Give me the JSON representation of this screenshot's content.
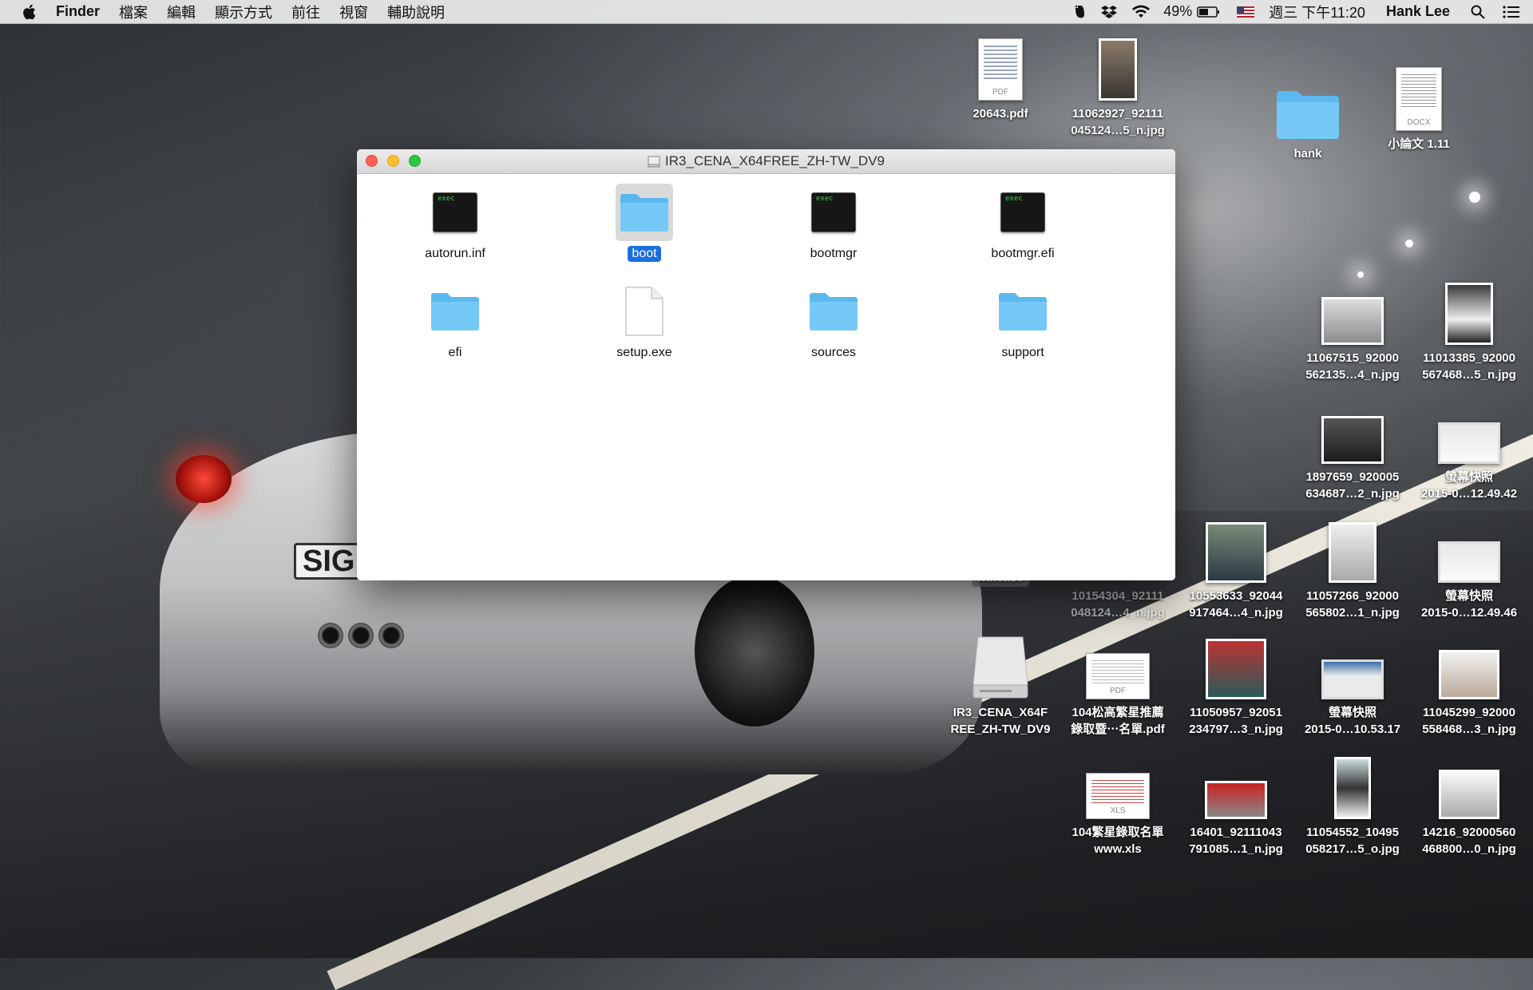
{
  "menubar": {
    "app_name": "Finder",
    "menus": [
      "檔案",
      "編輯",
      "顯示方式",
      "前往",
      "視窗",
      "輔助說明"
    ],
    "battery": "49%",
    "datetime": "週三 下午11:20",
    "user": "Hank Lee",
    "icons": [
      "apple-logo-icon",
      "evernote-icon",
      "dropbox-icon",
      "wifi-icon",
      "battery-icon",
      "flag-us-icon",
      "spotlight-search-icon",
      "notification-center-icon"
    ]
  },
  "wallpaper": {
    "plate_text": "SIG"
  },
  "window": {
    "title": "IR3_CENA_X64FREE_ZH-TW_DV9",
    "items": [
      {
        "name": "autorun.inf",
        "kind": "exec",
        "badge": "exec"
      },
      {
        "name": "boot",
        "kind": "folder",
        "selected": true
      },
      {
        "name": "bootmgr",
        "kind": "exec",
        "badge": "exec"
      },
      {
        "name": "bootmgr.efi",
        "kind": "exec",
        "badge": "exec"
      },
      {
        "name": "efi",
        "kind": "folder"
      },
      {
        "name": "setup.exe",
        "kind": "document"
      },
      {
        "name": "sources",
        "kind": "folder"
      },
      {
        "name": "support",
        "kind": "folder"
      }
    ]
  },
  "desktop": {
    "items": [
      {
        "line1": "20643.pdf",
        "line2": "",
        "kind": "pdf",
        "badge": "PDF"
      },
      {
        "line1": "11062927_92111",
        "line2": "045124…5_n.jpg",
        "kind": "photo"
      },
      {
        "line1": "hank",
        "line2": "",
        "kind": "folder"
      },
      {
        "line1": "小論文  1.11",
        "line2": "",
        "kind": "docx",
        "badge": "DOCX"
      },
      {
        "line1": "11067515_92000",
        "line2": "562135…4_n.jpg",
        "kind": "photo"
      },
      {
        "line1": "11013385_92000",
        "line2": "567468…5_n.jpg",
        "kind": "photo"
      },
      {
        "line1": "1897659_920005",
        "line2": "634687…2_n.jpg",
        "kind": "photo"
      },
      {
        "line1": "螢幕快照",
        "line2": "2015-0…12.49.42",
        "kind": "screenshot"
      },
      {
        "line1": "10154304_92111",
        "line2": "048124…4_n.jpg",
        "kind": "photo",
        "dim": true
      },
      {
        "line1": "10553633_92044",
        "line2": "917464…4_n.jpg",
        "kind": "photo"
      },
      {
        "line1": "11057266_92000",
        "line2": "565802…1_n.jpg",
        "kind": "photo"
      },
      {
        "line1": "螢幕快照",
        "line2": "2015-0…12.49.46",
        "kind": "screenshot"
      },
      {
        "line1": "win8.iso",
        "line2": "",
        "kind": "iso"
      },
      {
        "line1": "IR3_CENA_X64F",
        "line2": "REE_ZH-TW_DV9",
        "kind": "disk"
      },
      {
        "line1": "104松高繁星推薦",
        "line2": "錄取暨⋯名單.pdf",
        "kind": "pdf",
        "badge": "PDF"
      },
      {
        "line1": "11050957_92051",
        "line2": "234797…3_n.jpg",
        "kind": "photo"
      },
      {
        "line1": "螢幕快照",
        "line2": "2015-0…10.53.17",
        "kind": "screenshot"
      },
      {
        "line1": "11045299_92000",
        "line2": "558468…3_n.jpg",
        "kind": "photo"
      },
      {
        "line1": "104繁星錄取名單",
        "line2": "www.xls",
        "kind": "xls",
        "badge": "XLS"
      },
      {
        "line1": "16401_92111043",
        "line2": "791085…1_n.jpg",
        "kind": "photo"
      },
      {
        "line1": "11054552_10495",
        "line2": "058217…5_o.jpg",
        "kind": "photo"
      },
      {
        "line1": "14216_92000560",
        "line2": "468800…0_n.jpg",
        "kind": "photo"
      }
    ]
  },
  "colors": {
    "selection": "#1a6fe0",
    "folder": "#6ec6f5",
    "close": "#fc5f57",
    "minimize": "#fdbc2e",
    "zoom": "#28c840"
  }
}
